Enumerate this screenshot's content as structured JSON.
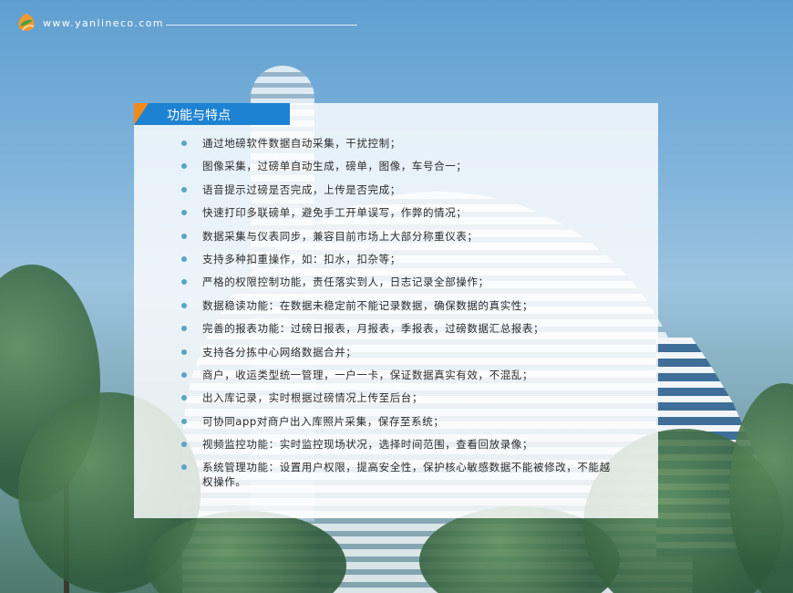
{
  "header": {
    "url": "www.yanlineco.com",
    "logo_icon": "orange-green-leaf-logo"
  },
  "panel": {
    "title": "功能与特点",
    "title_bg": "#1e82d2",
    "corner_accent": "#f08a1e",
    "bullet_color": "#58a4c6",
    "items": [
      "通过地磅软件数据自动采集，干扰控制；",
      "图像采集，过磅单自动生成，磅单，图像，车号合一；",
      "语音提示过磅是否完成，上传是否完成；",
      "快速打印多联磅单，避免手工开单误写，作弊的情况；",
      "数据采集与仪表同步，兼容目前市场上大部分称重仪表；",
      "支持多种扣重操作，如：扣水，扣杂等；",
      "严格的权限控制功能，责任落实到人，日志记录全部操作；",
      "数据稳读功能：在数据未稳定前不能记录数据，确保数据的真实性；",
      "完善的报表功能：过磅日报表，月报表，季报表，过磅数据汇总报表；",
      "支持各分拣中心网络数据合并；",
      "商户，收运类型统一管理，一户一卡，保证数据真实有效，不混乱；",
      "出入库记录，实时根据过磅情况上传至后台；",
      "可协同app对商户出入库照片采集，保存至系统；",
      "视频监控功能：实时监控现场状况，选择时间范围，查看回放录像；",
      "系统管理功能：设置用户权限，提高安全性，保护核心敏感数据不能被修改，不能越权操作。"
    ]
  }
}
